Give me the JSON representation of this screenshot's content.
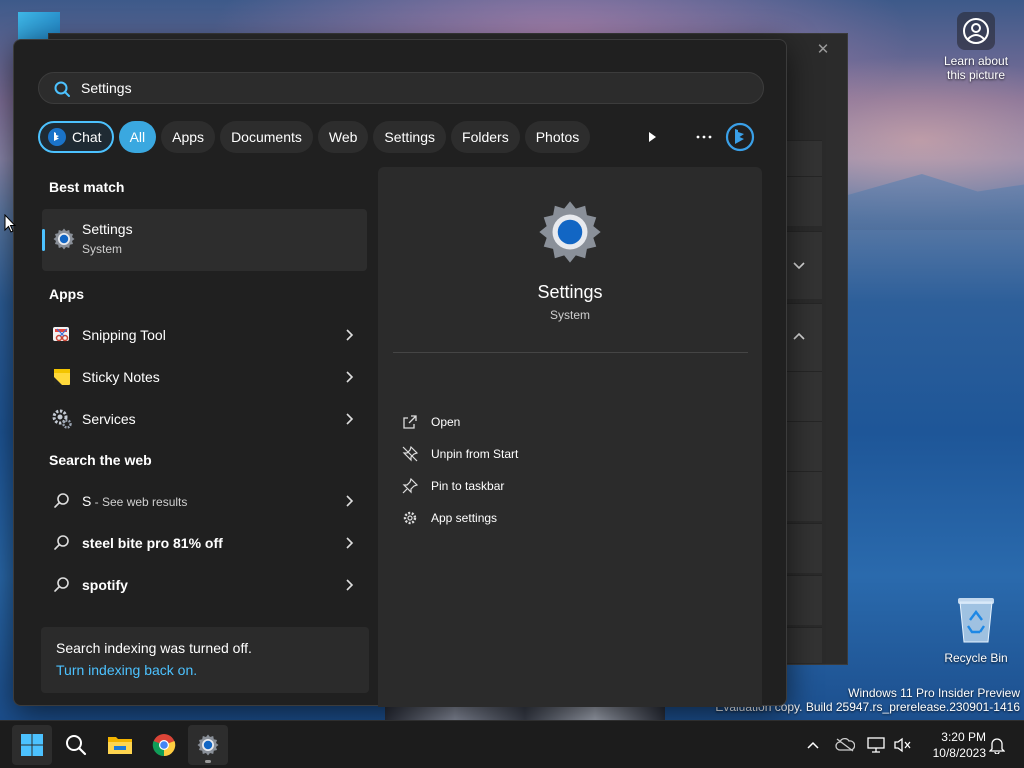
{
  "desktop": {
    "learn_icon_label": "Learn about this picture",
    "recycle_bin_label": "Recycle Bin",
    "watermark_line1": "Windows 11 Pro Insider Preview",
    "watermark_line2": "Evaluation copy. Build 25947.rs_prerelease.230901-1416"
  },
  "search": {
    "query": "Settings",
    "filters": [
      {
        "label": "Chat"
      },
      {
        "label": "All"
      },
      {
        "label": "Apps"
      },
      {
        "label": "Documents"
      },
      {
        "label": "Web"
      },
      {
        "label": "Settings"
      },
      {
        "label": "Folders"
      },
      {
        "label": "Photos"
      }
    ],
    "play_icon": "play-icon",
    "more_icon": "more-icon",
    "bing_icon": "bing-icon"
  },
  "results": {
    "best_match_title": "Best match",
    "best_match": {
      "name": "Settings",
      "subtitle": "System"
    },
    "apps_title": "Apps",
    "apps": [
      {
        "name": "Snipping Tool"
      },
      {
        "name": "Sticky Notes"
      },
      {
        "name": "Services"
      }
    ],
    "web_title": "Search the web",
    "web": [
      {
        "query": "S",
        "suffix": " - See web results"
      },
      {
        "query": "steel bite pro 81% off",
        "suffix": ""
      },
      {
        "query": "spotify",
        "suffix": ""
      }
    ],
    "notice_line1": "Search indexing was turned off.",
    "notice_link": "Turn indexing back on."
  },
  "detail": {
    "name": "Settings",
    "kind": "System",
    "actions": [
      {
        "label": "Open",
        "icon": "open-external-icon"
      },
      {
        "label": "Unpin from Start",
        "icon": "unpin-icon"
      },
      {
        "label": "Pin to taskbar",
        "icon": "pin-icon"
      },
      {
        "label": "App settings",
        "icon": "gear-icon"
      }
    ]
  },
  "taskbar": {
    "time": "3:20 PM",
    "date": "10/8/2023"
  },
  "colors": {
    "accent": "#4cc2ff",
    "panel_bg": "#202020",
    "pane_bg": "#2b2b2b"
  }
}
